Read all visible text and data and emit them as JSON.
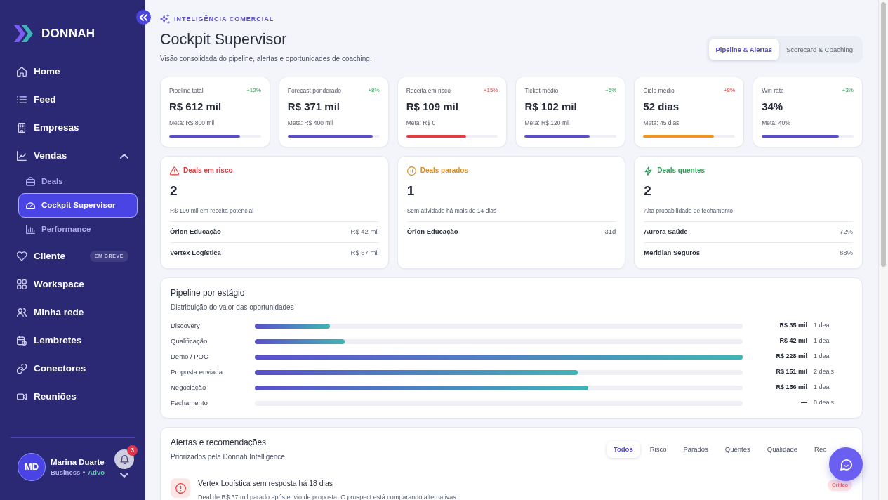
{
  "sidebar": {
    "logo": "DONNAH",
    "nav": [
      {
        "label": "Home",
        "selected": false
      },
      {
        "label": "Feed",
        "selected": false
      },
      {
        "label": "Empresas",
        "selected": false
      },
      {
        "label": "Vendas",
        "selected": false,
        "expanded": true,
        "children": [
          {
            "label": "Deals",
            "selected": false
          },
          {
            "label": "Cockpit Supervisor",
            "selected": true
          },
          {
            "label": "Performance",
            "selected": false
          }
        ]
      },
      {
        "label": "Cliente",
        "selected": false,
        "badge": "EM BREVE"
      },
      {
        "label": "Workspace",
        "selected": false
      },
      {
        "label": "Minha rede",
        "selected": false
      },
      {
        "label": "Lembretes",
        "selected": false
      },
      {
        "label": "Conectores",
        "selected": false
      },
      {
        "label": "Reuniões",
        "selected": false
      }
    ],
    "user": {
      "initials": "MD",
      "name": "Marina Duarte",
      "plan": "Business",
      "state_label": "Ativo",
      "active": true,
      "notifications": "3"
    }
  },
  "header": {
    "eyebrow": "INTELIGÊNCIA COMERCIAL",
    "title": "Cockpit Supervisor",
    "subtitle": "Visão consolidada do pipeline, alertas e oportunidades de coaching.",
    "view_tabs": [
      {
        "label": "Pipeline & Alertas",
        "selected": true
      },
      {
        "label": "Scorecard & Coaching",
        "selected": false
      }
    ]
  },
  "kpis": [
    {
      "label": "Pipeline total",
      "change": "+12%",
      "change_positive": true,
      "value": "R$ 612 mil",
      "target": "Meta: R$ 800 mil",
      "level": 0.77,
      "color": "#5a4fc8"
    },
    {
      "label": "Forecast ponderado",
      "change": "+8%",
      "change_positive": true,
      "value": "R$ 371 mil",
      "target": "Meta: R$ 400 mil",
      "level": 0.93,
      "color": "#5a4fc8"
    },
    {
      "label": "Receita em risco",
      "change": "+15%",
      "change_positive": false,
      "value": "R$ 109 mil",
      "target": "Meta: R$ 0",
      "level": 0.65,
      "color": "#e53e3e"
    },
    {
      "label": "Ticket médio",
      "change": "+5%",
      "change_positive": true,
      "value": "R$ 102 mil",
      "target": "Meta: R$ 120 mil",
      "level": 0.71,
      "color": "#5a4fc8"
    },
    {
      "label": "Ciclo médio",
      "change": "+8%",
      "change_positive": false,
      "value": "52 dias",
      "target": "Meta: 45 dias",
      "level": 0.77,
      "color": "#f0951e"
    },
    {
      "label": "Win rate",
      "change": "+3%",
      "change_positive": true,
      "value": "34%",
      "target": "Meta: 40%",
      "level": 0.84,
      "color": "#5a4fc8"
    }
  ],
  "deal_groups": [
    {
      "kind": "risk",
      "title": "Deals em risco",
      "count": "2",
      "caption": "R$ 109 mil em receita potencial",
      "deals": [
        {
          "name": "Órion Educação",
          "value": "R$ 42 mil"
        },
        {
          "name": "Vertex Logística",
          "value": "R$ 67 mil"
        }
      ]
    },
    {
      "kind": "stalled",
      "title": "Deals parados",
      "count": "1",
      "caption": "Sem atividade há mais de 14 dias",
      "deals": [
        {
          "name": "Órion Educação",
          "value": "31d"
        }
      ]
    },
    {
      "kind": "hot",
      "title": "Deals quentes",
      "count": "2",
      "caption": "Alta probabilidade de fechamento",
      "deals": [
        {
          "name": "Aurora Saúde",
          "value": "72%"
        },
        {
          "name": "Meridian Seguros",
          "value": "88%"
        }
      ]
    }
  ],
  "pipeline": {
    "title": "Pipeline por estágio",
    "subtitle": "Distribuição do valor das oportunidades",
    "stages": [
      {
        "name": "Discovery",
        "level": 0.154,
        "value": "R$ 35 mil",
        "deals": "1 deal"
      },
      {
        "name": "Qualificação",
        "level": 0.184,
        "value": "R$ 42 mil",
        "deals": "1 deal"
      },
      {
        "name": "Demo / POC",
        "level": 1,
        "value": "R$ 228 mil",
        "deals": "1 deal"
      },
      {
        "name": "Proposta enviada",
        "level": 0.662,
        "value": "R$ 151 mil",
        "deals": "2 deals"
      },
      {
        "name": "Negociação",
        "level": 0.684,
        "value": "R$ 156 mil",
        "deals": "1 deal"
      },
      {
        "name": "Fechamento",
        "value": "—",
        "deals": "0 deals"
      }
    ]
  },
  "alerts": {
    "title": "Alertas e recomendações",
    "subtitle": "Priorizados pela Donnah Intelligence",
    "filters": [
      {
        "label": "Todos",
        "selected": true
      },
      {
        "label": "Risco",
        "selected": false
      },
      {
        "label": "Parados",
        "selected": false
      },
      {
        "label": "Quentes",
        "selected": false
      },
      {
        "label": "Qualidade",
        "selected": false
      },
      {
        "label": "Rec",
        "selected": false
      }
    ],
    "items": [
      {
        "kind": "critical",
        "title": "Vertex Logística sem resposta há 18 dias",
        "badge": "Crítico",
        "description": "Deal de R$ 67 mil parado após envio de proposta. O prospect está comparando alternativas."
      }
    ]
  }
}
